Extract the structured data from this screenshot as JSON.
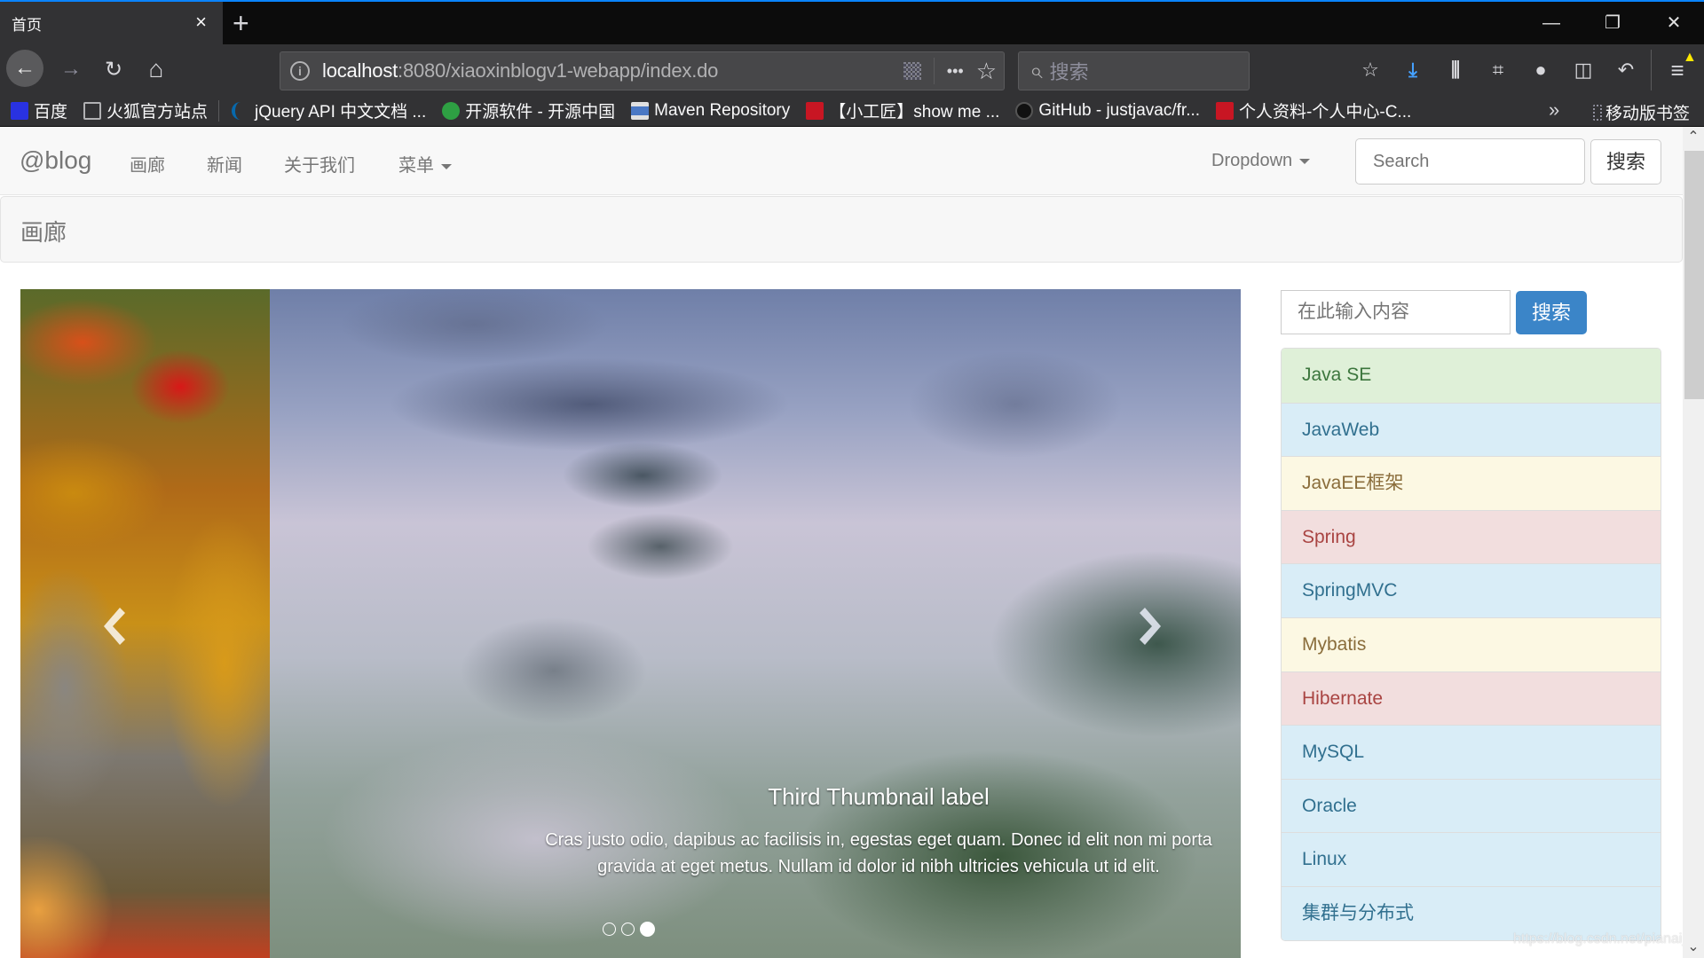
{
  "browser": {
    "tab": {
      "title": "首页",
      "close_icon": "×"
    },
    "new_tab_icon": "+",
    "window_controls": {
      "minimize": "—",
      "restore": "❐",
      "close": "✕"
    },
    "nav": {
      "back": "←",
      "forward": "→",
      "reload": "↻",
      "home": "⌂"
    },
    "url": {
      "host": "localhost",
      "rest": ":8080/xiaoxinblogv1-webapp/index.do"
    },
    "url_actions": {
      "more": "•••",
      "bookmark_star": "☆"
    },
    "search": {
      "placeholder": "搜索",
      "icon": "⌕"
    },
    "toolbar_icons": [
      "pocket-icon",
      "download-icon",
      "library-icon",
      "screenshot-icon",
      "chat-icon",
      "sidebar-icon",
      "undo-icon",
      "menu-icon"
    ],
    "bookmarks": [
      {
        "label": "百度",
        "icon": "baidu-icon",
        "color": "#2932e1"
      },
      {
        "label": "火狐官方站点",
        "icon": "folder-icon",
        "color": "#8f8f9d"
      },
      {
        "label": "jQuery API 中文文档 ...",
        "icon": "jquery-icon",
        "color": "#0769ad"
      },
      {
        "label": "开源软件 - 开源中国",
        "icon": "oschina-icon",
        "color": "#2ea043"
      },
      {
        "label": "Maven Repository",
        "icon": "maven-icon",
        "color": "#4a78c4"
      },
      {
        "label": "【小工匠】show me ...",
        "icon": "csdn-icon",
        "color": "#c81623"
      },
      {
        "label": "GitHub - justjavac/fr...",
        "icon": "github-icon",
        "color": "#111111"
      },
      {
        "label": "个人资料-个人中心-C...",
        "icon": "csdn-icon",
        "color": "#c81623"
      }
    ],
    "bookmarks_overflow": "»",
    "mobile_bookmarks": "移动版书签"
  },
  "page": {
    "navbar": {
      "brand": "@blog",
      "links": [
        "画廊",
        "新闻",
        "关于我们"
      ],
      "menu_dropdown": "菜单",
      "right_dropdown": "Dropdown",
      "search_placeholder": "Search",
      "search_button": "搜索"
    },
    "jumbotron": {
      "title": "画廊"
    },
    "carousel": {
      "caption_title": "Third Thumbnail label",
      "caption_text": "Cras justo odio, dapibus ac facilisis in, egestas eget quam. Donec id elit non mi porta gravida at eget metus. Nullam id dolor id nibh ultricies vehicula ut id elit.",
      "slide_count": 3,
      "active_index": 2
    },
    "sidebar": {
      "search_placeholder": "在此输入内容",
      "search_button": "搜索",
      "categories": [
        {
          "label": "Java SE",
          "variant": "success"
        },
        {
          "label": "JavaWeb",
          "variant": "info"
        },
        {
          "label": "JavaEE框架",
          "variant": "warning"
        },
        {
          "label": "Spring",
          "variant": "danger"
        },
        {
          "label": "SpringMVC",
          "variant": "info"
        },
        {
          "label": "Mybatis",
          "variant": "warning"
        },
        {
          "label": "Hibernate",
          "variant": "danger"
        },
        {
          "label": "MySQL",
          "variant": "info"
        },
        {
          "label": "Oracle",
          "variant": "info"
        },
        {
          "label": "Linux",
          "variant": "info"
        },
        {
          "label": "集群与分布式",
          "variant": "info"
        }
      ]
    },
    "watermark": "https://blog.csdn.net/pianai_s"
  },
  "colors": {
    "accent_blue": "#0a84ff",
    "primary_button": "#3b85c8",
    "success_bg": "#dff0d8",
    "info_bg": "#d9edf7",
    "warning_bg": "#fcf8e3",
    "danger_bg": "#f2dede"
  }
}
